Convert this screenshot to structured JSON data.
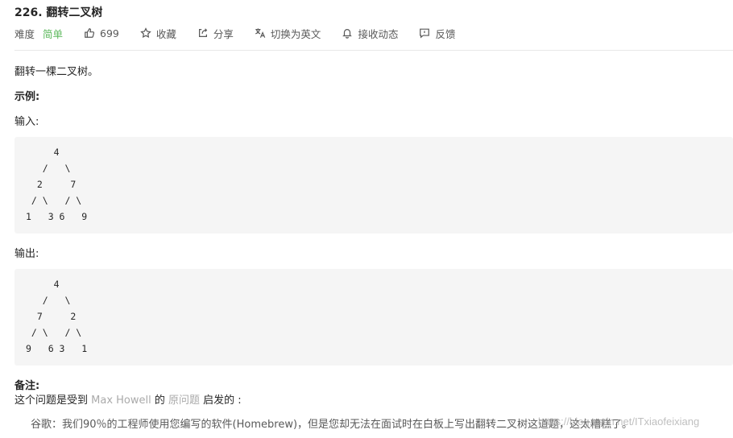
{
  "problem": {
    "title": "226. 翻转二叉树",
    "difficulty_label": "难度",
    "difficulty_value": "简单",
    "likes": "699",
    "actions": {
      "favorite": "收藏",
      "share": "分享",
      "translate": "切换为英文",
      "subscribe": "接收动态",
      "feedback": "反馈"
    }
  },
  "content": {
    "description": "翻转一棵二叉树。",
    "example_heading": "示例:",
    "input_label": "输入:",
    "input_tree": "     4\n   /   \\\n  2     7\n / \\   / \\\n1   3 6   9",
    "output_label": "输出:",
    "output_tree": "     4\n   /   \\\n  7     2\n / \\   / \\\n9   6 3   1",
    "note_heading": "备注:",
    "note_prefix": "这个问题是受到 ",
    "note_link1": "Max Howell",
    "note_mid": " 的 ",
    "note_link2": "原问题",
    "note_suffix": " 启发的 :",
    "quote": "谷歌：我们90％的工程师使用您编写的软件(Homebrew)，但是您却无法在面试时在白板上写出翻转二叉树这道题，这太糟糕了。"
  },
  "watermark": "https://blog.csdn.net/ITxiaofeixiang"
}
